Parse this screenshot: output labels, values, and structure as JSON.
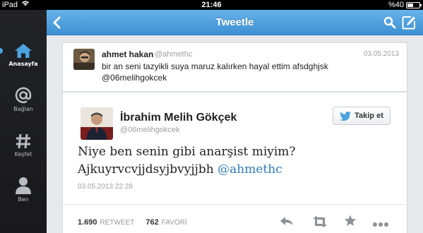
{
  "status_bar": {
    "device": "iPad",
    "time": "21:46",
    "battery": "%40"
  },
  "sidebar": {
    "items": [
      {
        "label": "Anasayfa",
        "icon": "home-icon",
        "active": true
      },
      {
        "label": "Bağlan",
        "icon": "at-sign-icon",
        "active": false
      },
      {
        "label": "Keşfet",
        "icon": "hashtag-icon",
        "active": false
      },
      {
        "label": "Ben",
        "icon": "person-icon",
        "active": false
      }
    ]
  },
  "header": {
    "title": "Tweetle"
  },
  "reply": {
    "name": "ahmet hakan",
    "handle": "@ahmethc",
    "date": "03.05.2013",
    "text": "bir an seni tazyikli suya maruz kalırken hayal ettim afsdghjsk @06melihgokcek"
  },
  "tweet": {
    "name": "İbrahim Melih Gökçek",
    "handle": "@06melihgokcek",
    "follow_label": "Takip et",
    "text_main": "Niye ben senin gibi anarşist miyim? Ajkuyrvcvjjdsyjbvyjjbh ",
    "mention": "@ahmethc",
    "timestamp": "03.05.2013 22:28",
    "retweet_count": "1.690",
    "retweet_label": "RETWEET",
    "favorite_count": "762",
    "favorite_label": "FAVORİ"
  },
  "colors": {
    "accent": "#4aa3df",
    "header": "#4f9fe0",
    "mention": "#2b7bb9"
  }
}
